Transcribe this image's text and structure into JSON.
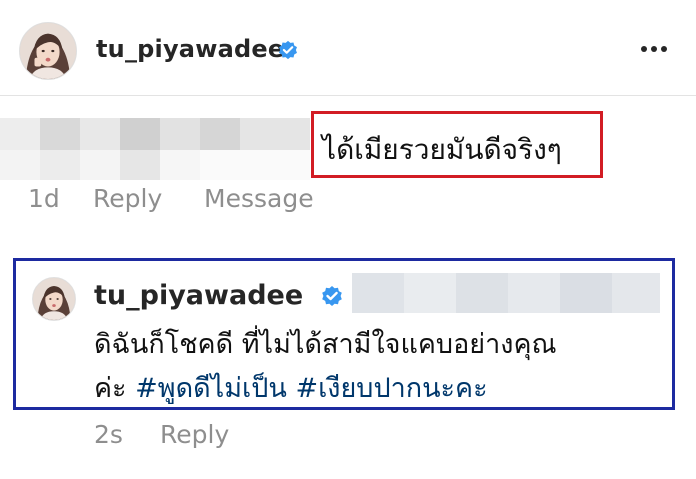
{
  "post_header": {
    "username": "tu_piyawadee",
    "verified": true,
    "avatar_icon": "profile-photo",
    "more_icon": "more-horizontal-icon"
  },
  "comment": {
    "text": "ได้เมียรวยมันดีจริงๆ",
    "time": "1d",
    "reply_label": "Reply",
    "message_label": "Message",
    "highlight_color": "#d21c24"
  },
  "reply_comment": {
    "username": "tu_piyawadee",
    "verified": true,
    "line1": "ดิฉันก็โชคดี ที่ไม่ได้สามีใจแคบอย่างคุณ",
    "line2_prefix": "ค่ะ ",
    "hashtag1": "#พูดดีไม่เป็น",
    "hashtag2": "#เงียบปากนะคะ",
    "time": "2s",
    "reply_label": "Reply",
    "highlight_color": "#1d2aa0"
  },
  "colors": {
    "verified_badge": "#3897f0",
    "hashtag": "#00376b",
    "meta_text": "#8e8e8e"
  }
}
